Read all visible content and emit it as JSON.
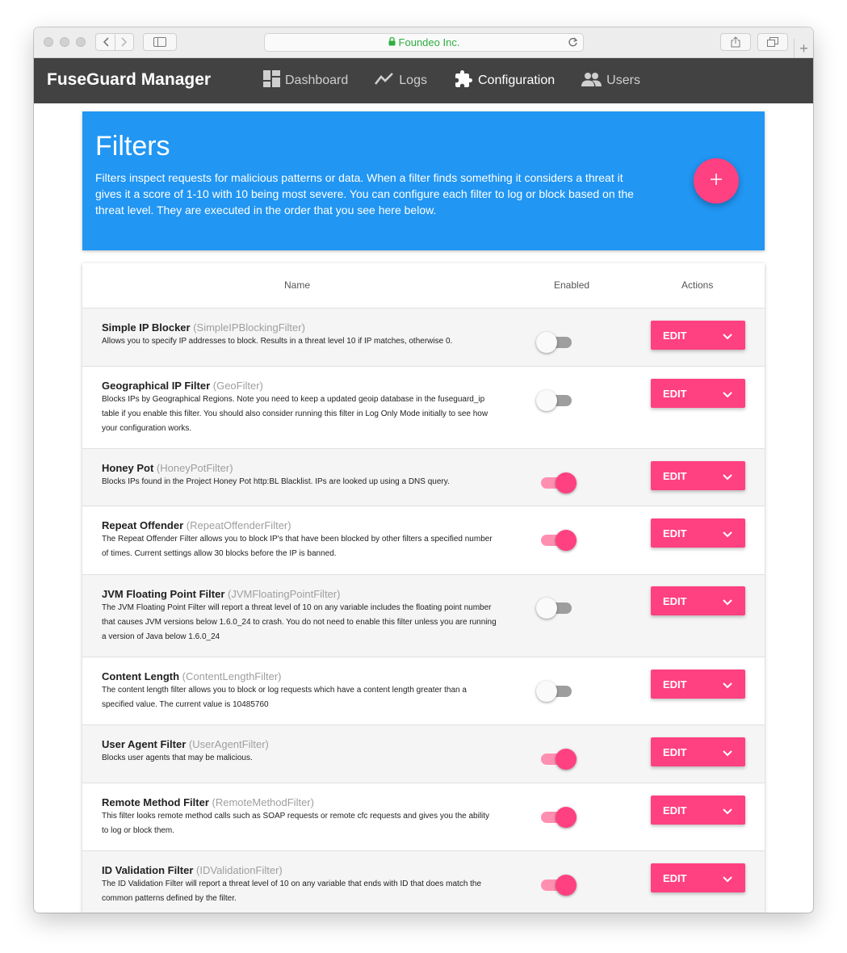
{
  "browser": {
    "address": "Foundeo Inc."
  },
  "app": {
    "title": "FuseGuard Manager",
    "nav": [
      {
        "label": "Dashboard",
        "icon": "dashboard-icon"
      },
      {
        "label": "Logs",
        "icon": "chart-line-icon"
      },
      {
        "label": "Configuration",
        "icon": "puzzle-icon",
        "active": true
      },
      {
        "label": "Users",
        "icon": "users-icon"
      }
    ]
  },
  "hero": {
    "title": "Filters",
    "description": "Filters inspect requests for malicious patterns or data. When a filter finds something it considers a threat it gives it a score of 1-10 with 10 being most severe. You can configure each filter to log or block based on the threat level. They are executed in the order that you see here below.",
    "add_label": "+"
  },
  "table": {
    "headers": {
      "name": "Name",
      "enabled": "Enabled",
      "actions": "Actions"
    },
    "edit_label": "EDIT",
    "rows": [
      {
        "name": "Simple IP Blocker",
        "class": "(SimpleIPBlockingFilter)",
        "desc": "Allows you to specify IP addresses to block. Results in a threat level 10 if IP matches, otherwise 0.",
        "enabled": false
      },
      {
        "name": "Geographical IP Filter",
        "class": "(GeoFilter)",
        "desc": "Blocks IPs by Geographical Regions. Note you need to keep a updated geoip database in the fuseguard_ip table if you enable this filter. You should also consider running this filter in Log Only Mode initially to see how your configuration works.",
        "enabled": false
      },
      {
        "name": "Honey Pot",
        "class": "(HoneyPotFilter)",
        "desc": "Blocks IPs found in the Project Honey Pot http:BL Blacklist. IPs are looked up using a DNS query.",
        "enabled": true
      },
      {
        "name": "Repeat Offender",
        "class": "(RepeatOffenderFilter)",
        "desc": "The Repeat Offender Filter allows you to block IP's that have been blocked by other filters a specified number of times. Current settings allow 30 blocks before the IP is banned.",
        "enabled": true
      },
      {
        "name": "JVM Floating Point Filter",
        "class": "(JVMFloatingPointFilter)",
        "desc": "The JVM Floating Point Filter will report a threat level of 10 on any variable includes the floating point number that causes JVM versions below 1.6.0_24 to crash. You do not need to enable this filter unless you are running a version of Java below 1.6.0_24",
        "enabled": false
      },
      {
        "name": "Content Length",
        "class": "(ContentLengthFilter)",
        "desc": "The content length filter allows you to block or log requests which have a content length greater than a specified value. The current value is 10485760",
        "enabled": false
      },
      {
        "name": "User Agent Filter",
        "class": "(UserAgentFilter)",
        "desc": "Blocks user agents that may be malicious.",
        "enabled": true
      },
      {
        "name": "Remote Method Filter",
        "class": "(RemoteMethodFilter)",
        "desc": "This filter looks remote method calls such as SOAP requests or remote cfc requests and gives you the ability to log or block them.",
        "enabled": true
      },
      {
        "name": "ID Validation Filter",
        "class": "(IDValidationFilter)",
        "desc": "The ID Validation Filter will report a threat level of 10 on any variable that ends with ID that does match the common patterns defined by the filter.",
        "enabled": true
      }
    ]
  },
  "colors": {
    "appbar": "#424242",
    "hero": "#2196f3",
    "accent": "#ff4081"
  }
}
